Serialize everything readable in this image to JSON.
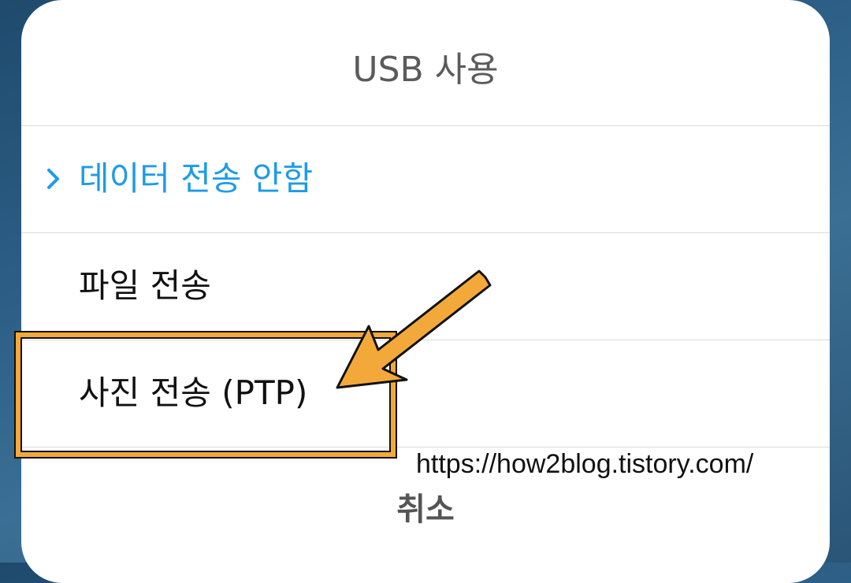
{
  "dialog": {
    "title": "USB 사용",
    "options": [
      {
        "label": "데이터 전송 안함",
        "selected": true
      },
      {
        "label": "파일 전송",
        "selected": false
      },
      {
        "label": "사진 전송 (PTP)",
        "selected": false
      }
    ],
    "cancel_label": "취소"
  },
  "annotation": {
    "watermark": "https://how2blog.tistory.com/",
    "highlight_color": "#f3a93a"
  },
  "colors": {
    "accent": "#1e9be8"
  }
}
